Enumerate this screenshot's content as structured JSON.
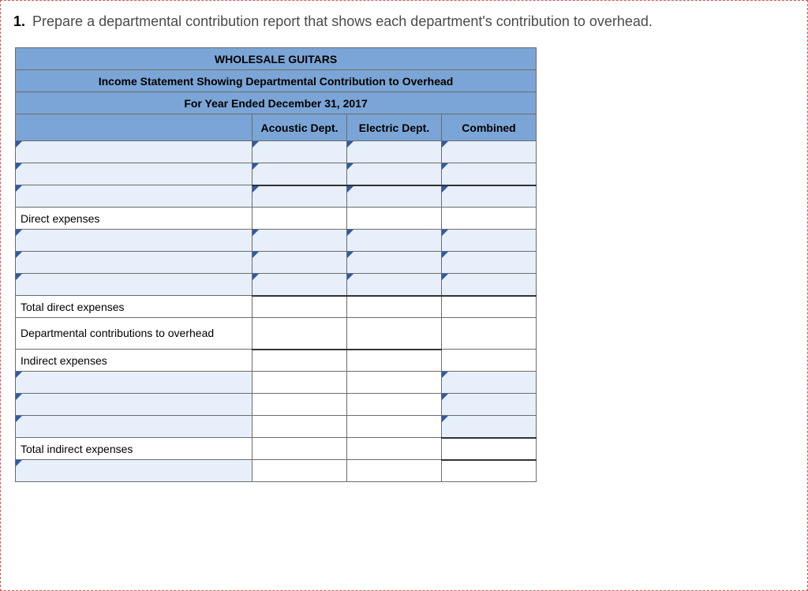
{
  "question": {
    "number": "1.",
    "text": "Prepare a departmental contribution report that shows each department's contribution to overhead."
  },
  "report": {
    "title": "WHOLESALE GUITARS",
    "subtitle": "Income Statement Showing Departmental Contribution to Overhead",
    "period": "For Year Ended December 31, 2017",
    "columns": {
      "label": "",
      "acoustic": "Acoustic Dept.",
      "electric": "Electric Dept.",
      "combined": "Combined"
    },
    "rows": {
      "blank1": {
        "label": "",
        "acoustic": "",
        "electric": "",
        "combined": ""
      },
      "blank2": {
        "label": "",
        "acoustic": "",
        "electric": "",
        "combined": ""
      },
      "blank3": {
        "label": "",
        "acoustic": "",
        "electric": "",
        "combined": ""
      },
      "direct_expenses_hdr": {
        "label": "Direct expenses"
      },
      "de1": {
        "label": "",
        "acoustic": "",
        "electric": "",
        "combined": ""
      },
      "de2": {
        "label": "",
        "acoustic": "",
        "electric": "",
        "combined": ""
      },
      "de3": {
        "label": "",
        "acoustic": "",
        "electric": "",
        "combined": ""
      },
      "total_direct": {
        "label": "Total direct expenses",
        "acoustic": "",
        "electric": "",
        "combined": ""
      },
      "dept_contrib": {
        "label": "Departmental contributions to overhead",
        "acoustic": "",
        "electric": "",
        "combined": ""
      },
      "indirect_hdr": {
        "label": "Indirect expenses"
      },
      "ie1": {
        "label": "",
        "combined": ""
      },
      "ie2": {
        "label": "",
        "combined": ""
      },
      "ie3": {
        "label": "",
        "combined": ""
      },
      "total_indirect": {
        "label": "Total indirect expenses",
        "combined": ""
      },
      "final": {
        "label": "",
        "combined": ""
      }
    }
  }
}
